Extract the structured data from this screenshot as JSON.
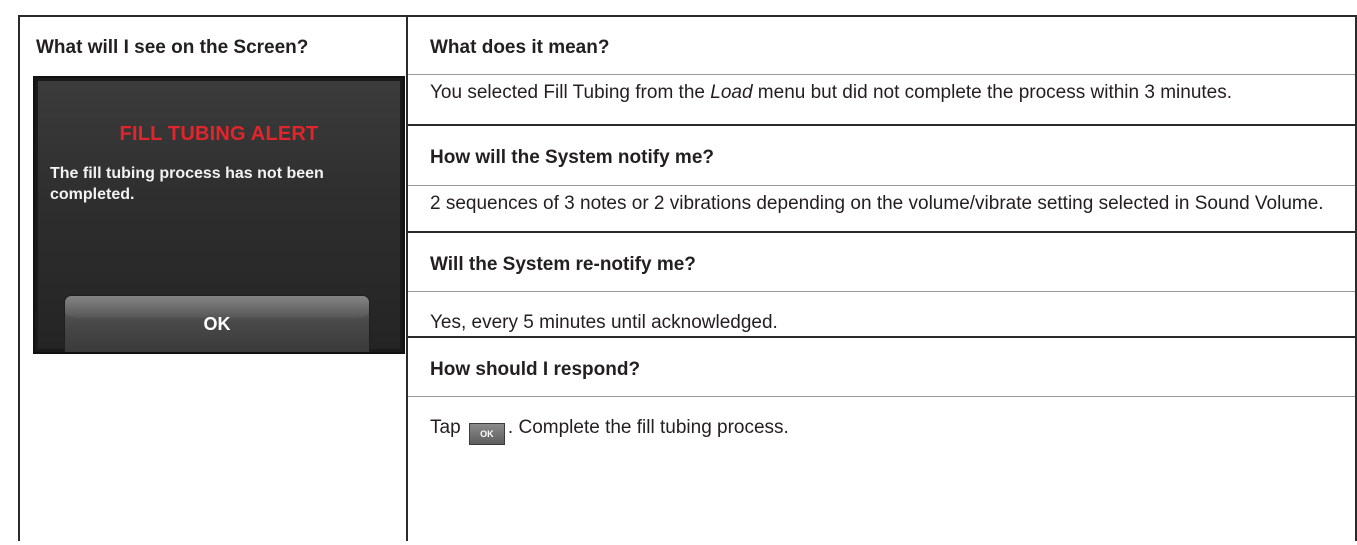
{
  "left": {
    "header": "What will I see on the Screen?",
    "screen": {
      "title": "FILL TUBING ALERT",
      "message": "The fill tubing process has not been completed.",
      "ok_label": "OK"
    }
  },
  "sections": [
    {
      "question": "What does it mean?",
      "answer_pre": "You selected ",
      "answer_bold": "Fill Tubing",
      "answer_mid": " from the ",
      "answer_italic": "Load",
      "answer_post": " menu but did not complete the process within 3 minutes."
    },
    {
      "question": "How will the System notify me?",
      "answer": "2 sequences of 3 notes or 2 vibrations depending on the volume/vibrate setting selected in Sound Volume."
    },
    {
      "question": "Will the System re-notify me?",
      "answer": "Yes, every 5 minutes until acknowledged."
    },
    {
      "question": "How should I respond?",
      "answer_pre": "Tap ",
      "icon_label": "OK",
      "answer_post": ". Complete the fill tubing process."
    }
  ],
  "colors": {
    "alert_title": "#e3242b",
    "screen_bg": "#2e2e2e",
    "border": "#2b2b2b"
  }
}
